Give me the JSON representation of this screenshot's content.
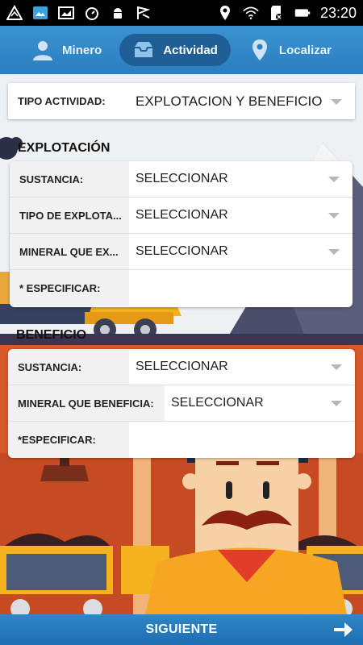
{
  "status_bar": {
    "time": "23:20",
    "left_icons": [
      "alert-icon",
      "image-icon",
      "gallery-icon",
      "sync-icon",
      "android-icon",
      "flag-icon"
    ],
    "right_icons": [
      "location-icon",
      "wifi-icon",
      "sdcard-icon",
      "battery-icon"
    ]
  },
  "nav": {
    "tabs": [
      {
        "label": "Minero",
        "icon": "user-icon",
        "active": false
      },
      {
        "label": "Actividad",
        "icon": "inbox-icon",
        "active": true
      },
      {
        "label": "Localizar",
        "icon": "location-pin-icon",
        "active": false
      }
    ]
  },
  "tipo_actividad": {
    "label": "TIPO ACTIVIDAD:",
    "value": "EXPLOTACION Y BENEFICIO"
  },
  "explotacion": {
    "title": "EXPLOTACIÓN",
    "fields": [
      {
        "label": "SUSTANCIA:",
        "value": "SELECCIONAR",
        "type": "select"
      },
      {
        "label": "TIPO DE EXPLOTA...",
        "value": "SELECCIONAR",
        "type": "select"
      },
      {
        "label": "MINERAL QUE EX...",
        "value": "SELECCIONAR",
        "type": "select"
      },
      {
        "label": "* ESPECIFICAR:",
        "value": "",
        "type": "input"
      }
    ]
  },
  "beneficio": {
    "title": "BENEFICIO",
    "fields": [
      {
        "label": "SUSTANCIA:",
        "value": "SELECCIONAR",
        "type": "select"
      },
      {
        "label": "MINERAL QUE BENEFICIA:",
        "value": "SELECCIONAR",
        "type": "select"
      },
      {
        "label": "*ESPECIFICAR:",
        "value": "",
        "type": "input"
      }
    ]
  },
  "footer": {
    "next_label": "SIGUIENTE"
  },
  "colors": {
    "nav_blue": "#2b7ec0",
    "tab_active": "#1f5f95",
    "button_blue": "#1e6eb0",
    "scene_orange": "#d9582b"
  }
}
